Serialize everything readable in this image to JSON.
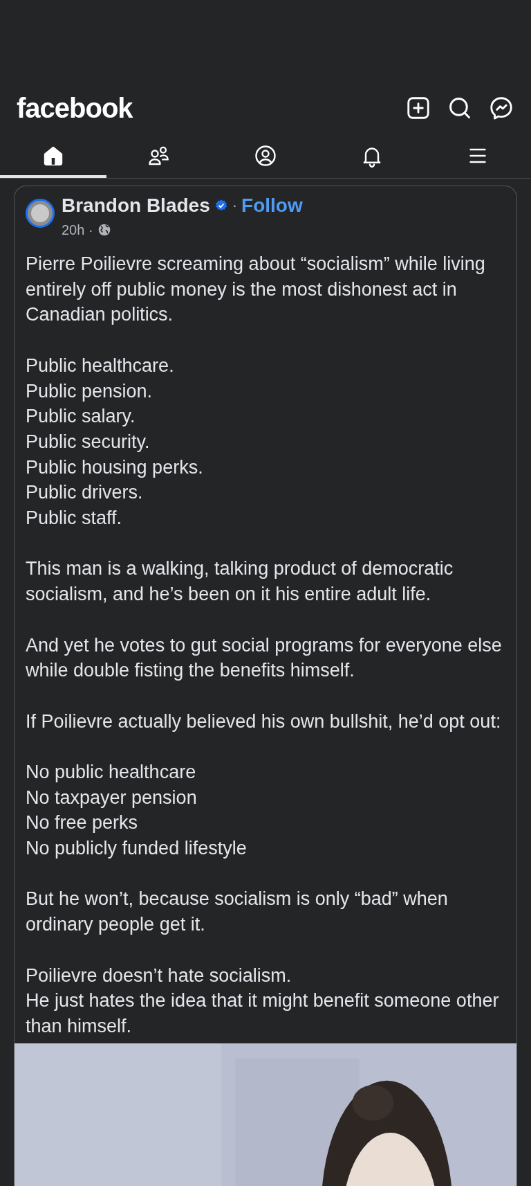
{
  "app_bar": {
    "logo": "facebook"
  },
  "tabs": [
    {
      "kind": "home",
      "selected": true
    },
    {
      "kind": "friends",
      "selected": false
    },
    {
      "kind": "profile",
      "selected": false
    },
    {
      "kind": "notifications",
      "selected": false
    },
    {
      "kind": "menu",
      "selected": false
    }
  ],
  "post": {
    "author": "Brandon Blades",
    "verified": true,
    "separator": "·",
    "follow": "Follow",
    "time": "20h ·",
    "paragraphs": [
      [
        "Pierre Poilievre screaming about “socialism” while living entirely off public money is the most dishonest act in Canadian politics."
      ],
      [
        "Public healthcare.",
        "Public pension.",
        "Public salary.",
        "Public security.",
        "Public housing perks.",
        "Public drivers.",
        "Public staff."
      ],
      [
        "This man is a walking, talking product of democratic socialism, and he’s been on it his entire adult life."
      ],
      [
        "And yet he votes to gut social programs for everyone else while double fisting the benefits himself."
      ],
      [
        "If Poilievre actually believed his own bullshit, he’d opt out:"
      ],
      [
        "No public healthcare",
        "No taxpayer pension",
        "No free perks",
        "No publicly funded lifestyle"
      ],
      [
        "But he won’t, because socialism is only “bad” when ordinary people get it."
      ],
      [
        "Poilievre doesn’t hate socialism.",
        "He just hates the idea that it might benefit someone other than himself."
      ]
    ],
    "media": {
      "kind": "picture"
    }
  }
}
